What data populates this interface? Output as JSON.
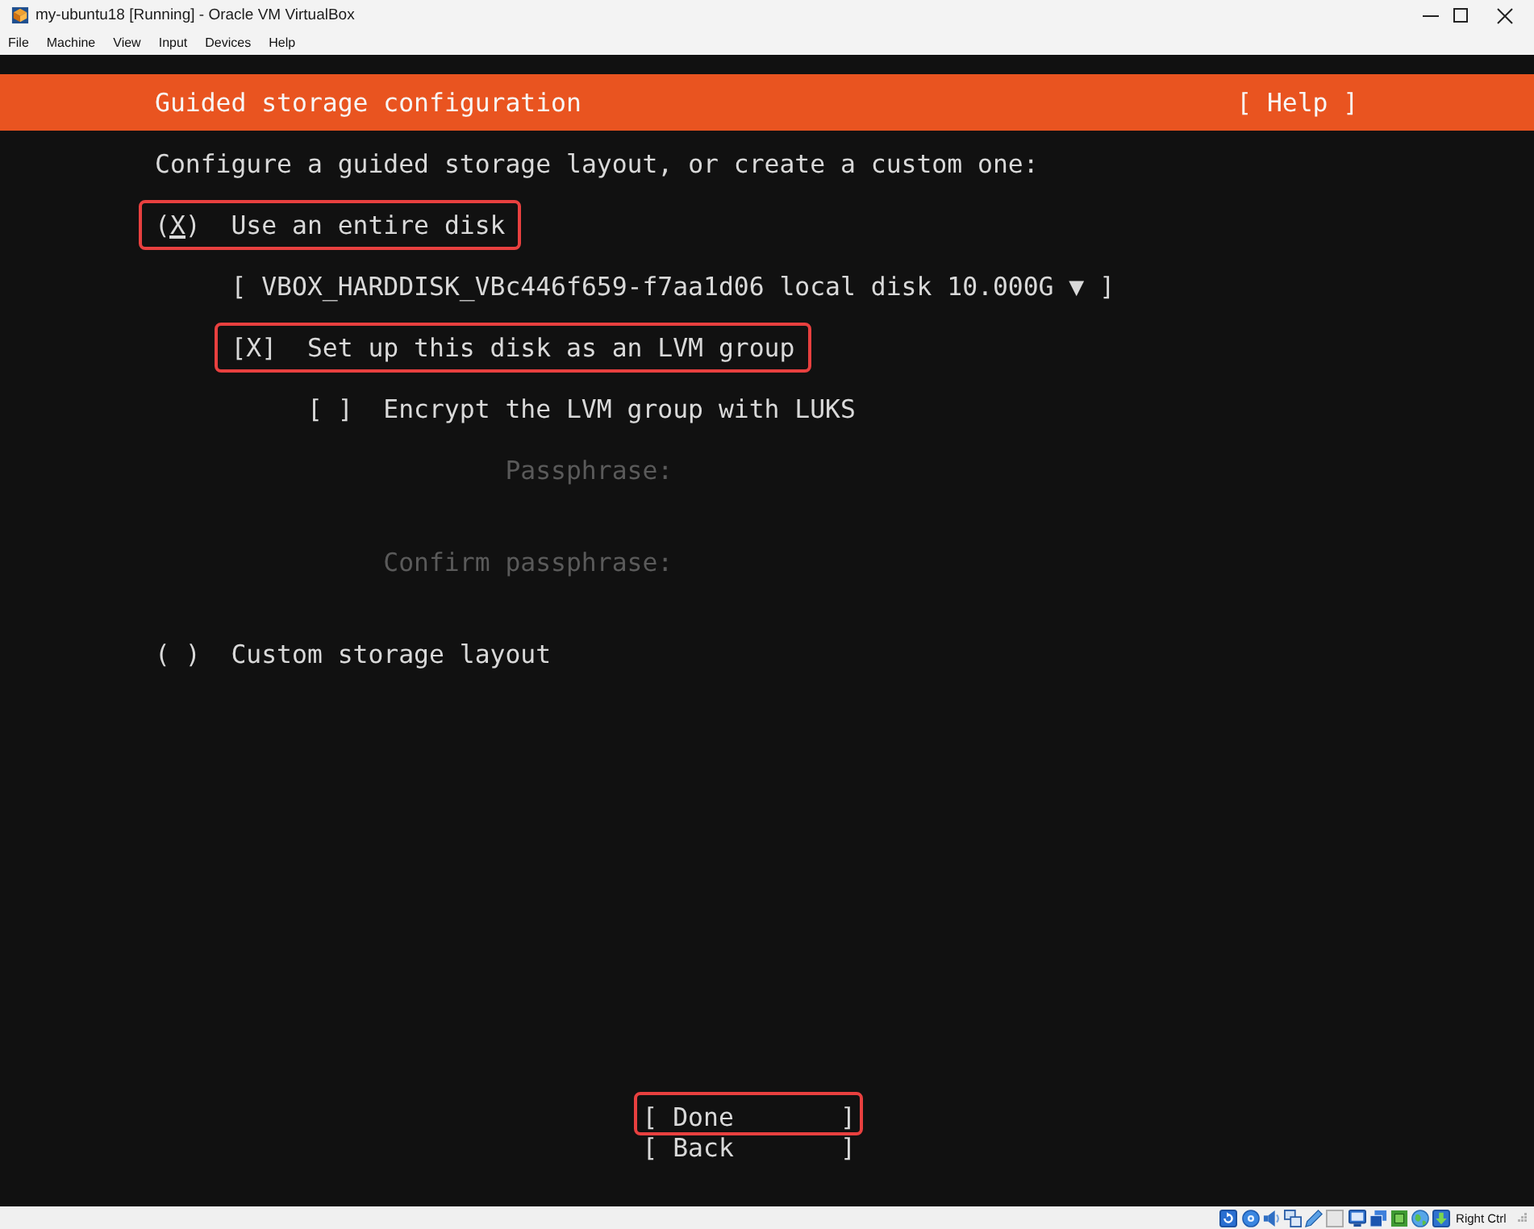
{
  "window": {
    "title": "my-ubuntu18 [Running] - Oracle VM VirtualBox"
  },
  "menu": [
    "File",
    "Machine",
    "View",
    "Input",
    "Devices",
    "Help"
  ],
  "header": {
    "title": "Guided storage configuration",
    "help": "[ Help ]"
  },
  "intro": "Configure a guided storage layout, or create a custom one:",
  "marks": {
    "radio_on": "(X)",
    "radio_off": "( )",
    "check_on": "[X]",
    "check_off": "[ ]"
  },
  "options": [
    {
      "kind": "radio",
      "label": "Use an entire disk",
      "selected": true,
      "focused": true,
      "highlighted": true,
      "children": [
        {
          "kind": "dropdown",
          "text": "[ VBOX_HARDDISK_VBc446f659-f7aa1d06 local disk 10.000G ▼ ]",
          "highlighted": false
        },
        {
          "kind": "checkbox",
          "label": "Set up this disk as an LVM group",
          "checked": true,
          "focused": false,
          "highlighted": true,
          "children": [
            {
              "kind": "checkbox",
              "label": "Encrypt the LVM group with LUKS",
              "checked": false,
              "focused": false,
              "highlighted": false,
              "children": [
                {
                  "kind": "field",
                  "label": "Passphrase:",
                  "disabled": true,
                  "highlighted": false
                },
                {
                  "kind": "field",
                  "label": "Confirm passphrase:",
                  "disabled": true,
                  "highlighted": false
                }
              ]
            }
          ]
        }
      ]
    },
    {
      "kind": "radio",
      "label": "Custom storage layout",
      "selected": false,
      "focused": false,
      "highlighted": false
    }
  ],
  "buttons": [
    {
      "label": "[ Done       ]",
      "highlighted": true
    },
    {
      "label": "[ Back       ]",
      "highlighted": false
    }
  ],
  "status_bar": {
    "host_key": "Right Ctrl"
  }
}
